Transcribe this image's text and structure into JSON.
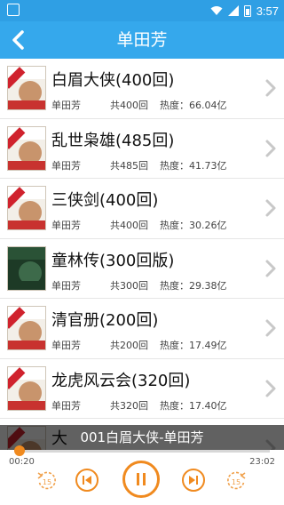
{
  "status": {
    "time": "3:57"
  },
  "header": {
    "title": "单田芳"
  },
  "items": [
    {
      "title": "白眉大侠(400回)",
      "author": "单田芳",
      "count": "共400回",
      "heat": "热度：66.04亿",
      "thumb": "cover-red"
    },
    {
      "title": "乱世枭雄(485回)",
      "author": "单田芳",
      "count": "共485回",
      "heat": "热度：41.73亿",
      "thumb": "cover-red"
    },
    {
      "title": "三侠剑(400回)",
      "author": "单田芳",
      "count": "共400回",
      "heat": "热度：30.26亿",
      "thumb": "cover-red"
    },
    {
      "title": "童林传(300回版)",
      "author": "单田芳",
      "count": "共300回",
      "heat": "热度：29.38亿",
      "thumb": "cover-green"
    },
    {
      "title": "清官册(200回)",
      "author": "单田芳",
      "count": "共200回",
      "heat": "热度：17.49亿",
      "thumb": "cover-red"
    },
    {
      "title": "龙虎风云会(320回)",
      "author": "单田芳",
      "count": "共320回",
      "heat": "热度：17.40亿",
      "thumb": "cover-red"
    },
    {
      "title": "大",
      "author": "",
      "count": "",
      "heat": "",
      "thumb": "cover-red"
    }
  ],
  "player": {
    "track": "001白眉大侠-单田芳",
    "current_time": "00:20",
    "total_time": "23:02",
    "progress": 0.015,
    "rewind_label": "15",
    "forward_label": "15",
    "accent": "#f08a1f"
  }
}
